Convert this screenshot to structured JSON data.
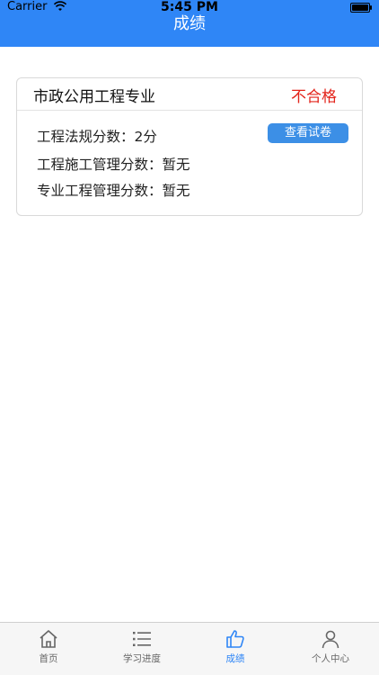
{
  "status_bar": {
    "carrier": "Carrier",
    "time": "5:45 PM"
  },
  "header": {
    "title": "成绩"
  },
  "card": {
    "major": "市政公用工程专业",
    "result": "不合格",
    "result_color": "#e3241b",
    "rows": [
      "工程法规分数：2分",
      "工程施工管理分数：暂无",
      "专业工程管理分数：暂无"
    ],
    "view_button": "查看试卷"
  },
  "tabbar": {
    "active_color": "#2f86f6",
    "items": [
      {
        "label": "首页",
        "icon": "home-icon"
      },
      {
        "label": "学习进度",
        "icon": "list-icon"
      },
      {
        "label": "成绩",
        "icon": "thumbs-up-icon",
        "active": true
      },
      {
        "label": "个人中心",
        "icon": "person-icon"
      }
    ]
  }
}
